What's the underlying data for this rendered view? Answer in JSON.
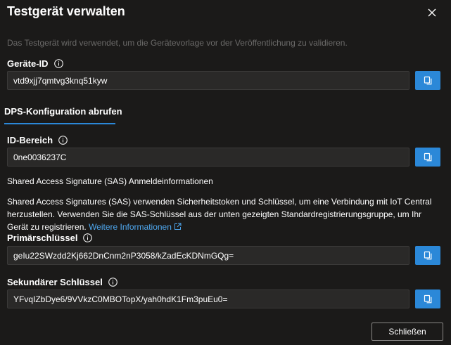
{
  "dialog": {
    "title": "Testgerät verwalten",
    "subtitle": "Das Testgerät wird verwendet, um die Gerätevorlage vor der Veröffentlichung zu validieren."
  },
  "device_id": {
    "label": "Geräte-ID",
    "value": "vtd9xjj7qmtvg3knq51kyw"
  },
  "tab": {
    "label": "DPS-Konfiguration abrufen"
  },
  "id_scope": {
    "label": "ID-Bereich",
    "value": "0ne0036237C"
  },
  "sas": {
    "heading": "Shared Access Signature (SAS) Anmeldeinformationen",
    "description": "Shared Access Signatures (SAS) verwenden Sicherheitstoken und Schlüssel, um eine Verbindung mit IoT Central herzustellen. Verwenden Sie die SAS-Schlüssel aus der unten gezeigten Standardregistrierungsgruppe, um Ihr Gerät zu registrieren.",
    "link_text": "Weitere Informationen"
  },
  "primary_key": {
    "label": "Primärschlüssel",
    "value": "geIu22SWzdd2Kj662DnCnm2nP3058/kZadEcKDNmGQg="
  },
  "secondary_key": {
    "label": "Sekundärer Schlüssel",
    "value": "YFvqIZbDye6/9VVkzC0MBOTopX/yah0hdK1Fm3puEu0="
  },
  "footer": {
    "close_label": "Schließen"
  },
  "colors": {
    "background": "#1b1a19",
    "accent": "#2b88d8",
    "link": "#4fa8f0"
  }
}
